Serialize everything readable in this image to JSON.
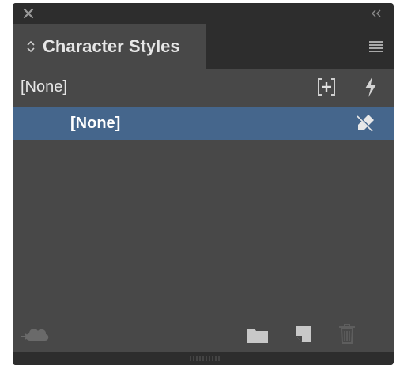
{
  "panel": {
    "tab_title": "Character Styles",
    "basic_style_label": "[None]",
    "selected_style_label": "[None]"
  },
  "icons": {
    "close": "close-icon",
    "collapse": "double-chevron-left-icon",
    "tab_arrows": "up-down-arrows-icon",
    "menu": "hamburger-menu-icon",
    "add": "create-style-icon",
    "bolt": "lightning-bolt-icon",
    "pen": "override-pen-icon",
    "cloud": "cc-libraries-cloud-icon",
    "folder": "new-group-folder-icon",
    "new_style": "new-style-icon",
    "delete": "trash-icon"
  },
  "colors": {
    "panel_bg": "#484848",
    "bar_bg": "#2d2d2d",
    "selected_row": "#45668c",
    "text": "#e6e6e6"
  }
}
